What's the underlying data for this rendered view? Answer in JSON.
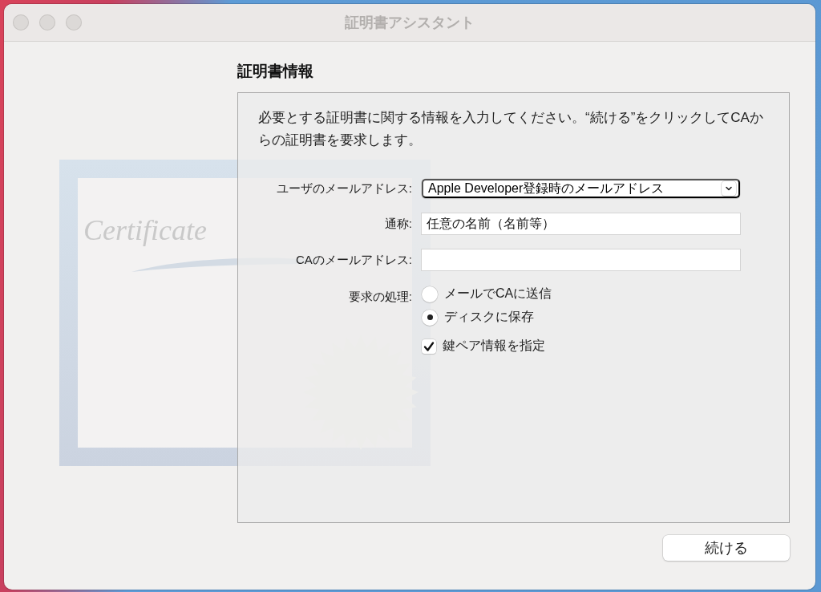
{
  "window": {
    "title": "証明書アシスタント"
  },
  "section_title": "証明書情報",
  "instructions": "必要とする証明書に関する情報を入力してください。“続ける”をクリックしてCAからの証明書を要求します。",
  "artwork_text": "Certificate",
  "form": {
    "fields": [
      {
        "kind": "popup",
        "label": "ユーザのメールアドレス:",
        "value": "Apple Developer登録時のメールアドレス"
      },
      {
        "kind": "text",
        "label": "通称:",
        "value": "任意の名前（名前等）"
      },
      {
        "kind": "text",
        "label": "CAのメールアドレス:"
      }
    ],
    "request": {
      "label": "要求の処理:",
      "options": [
        {
          "label": "メールでCAに送信",
          "selected": false
        },
        {
          "label": "ディスクに保存",
          "selected": true
        }
      ]
    },
    "checkbox": {
      "label": "鍵ペア情報を指定",
      "checked": true
    }
  },
  "buttons": [
    {
      "label": "続ける"
    }
  ]
}
